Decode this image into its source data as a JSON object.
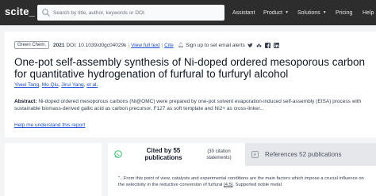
{
  "header": {
    "logo": "scite_",
    "search_placeholder": "Search by title, author, keywords or DOI",
    "nav": {
      "assistant": "Assistant",
      "product": "Product",
      "solutions": "Solutions",
      "pricing": "Pricing",
      "help": "Help"
    }
  },
  "paper": {
    "journal_badge": "Green Chem.",
    "year": "2021",
    "doi": "DOI: 10.1039/d0gc04029k",
    "full_text": "View full text",
    "cite": "Cite",
    "alerts": "Sign up to set email alerts",
    "title": "One-pot self-assembly synthesis of Ni-doped ordered mesoporous carbon for quantitative hydrogenation of furfural to furfuryl alcohol",
    "authors": [
      "Yiwei Tang",
      "Mo Qiu",
      "Jirui Yang",
      "et al."
    ],
    "abstract_label": "Abstract:",
    "abstract": "Ni-doped ordered mesoporous carbons (Ni@OMC) were prepared by one-pot solvent evaporation-induced self-assembly (EISA) process with sustainable biomass-derived gallic acid as carbon precursor, F127 as soft template and Ni2+ as cross-linker...",
    "help_link": "Help me understand this report"
  },
  "citations": {
    "cited_by": "Cited by 55 publications",
    "citation_statements": "(30 citation statements)",
    "references": "References 52 publications",
    "snippet_before": "\"...From this point of view, catalysts and experimental conditions are the main factors which impose a crucial influence on the selectivity in the reductive conversion of furfural ",
    "snippet_ref": "[4,5]",
    "snippet_after": ". Supported noble metal"
  }
}
